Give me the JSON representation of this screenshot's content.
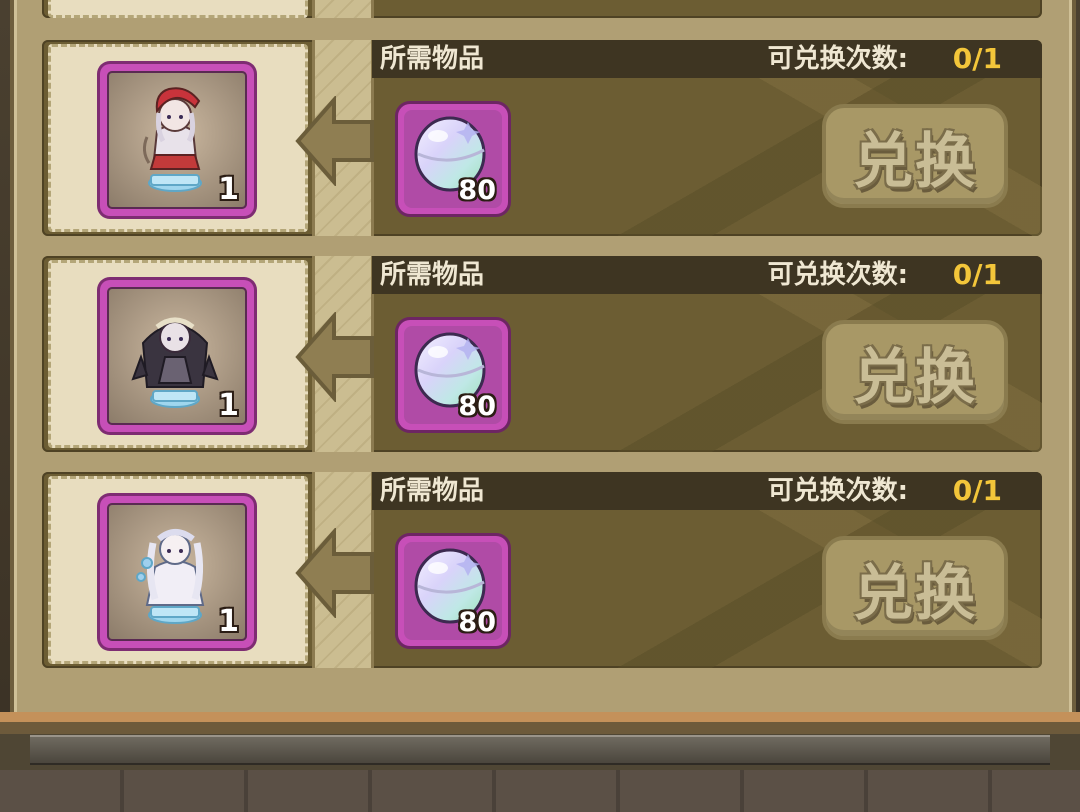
{
  "colors": {
    "accent_count": "#f3c63a",
    "card_border": "#c74fb8",
    "header_bg": "#3e3522",
    "button_disabled": "#a89866"
  },
  "rows": [
    {
      "requirement_label": "所需物品",
      "count_label": "可兑换次数:",
      "count_value": "0/1",
      "reward_icon": "red-hood-figurine-icon",
      "reward_qty": "1",
      "cost_icon": "rainbow-orb-icon",
      "cost_qty": "80",
      "button_label": "兑换"
    },
    {
      "requirement_label": "所需物品",
      "count_label": "可兑换次数:",
      "count_value": "0/1",
      "reward_icon": "dark-cloak-figurine-icon",
      "reward_qty": "1",
      "cost_icon": "rainbow-orb-icon",
      "cost_qty": "80",
      "button_label": "兑换"
    },
    {
      "requirement_label": "所需物品",
      "count_label": "可兑换次数:",
      "count_value": "0/1",
      "reward_icon": "white-dress-figurine-icon",
      "reward_qty": "1",
      "cost_icon": "rainbow-orb-icon",
      "cost_qty": "80",
      "button_label": "兑换"
    }
  ]
}
